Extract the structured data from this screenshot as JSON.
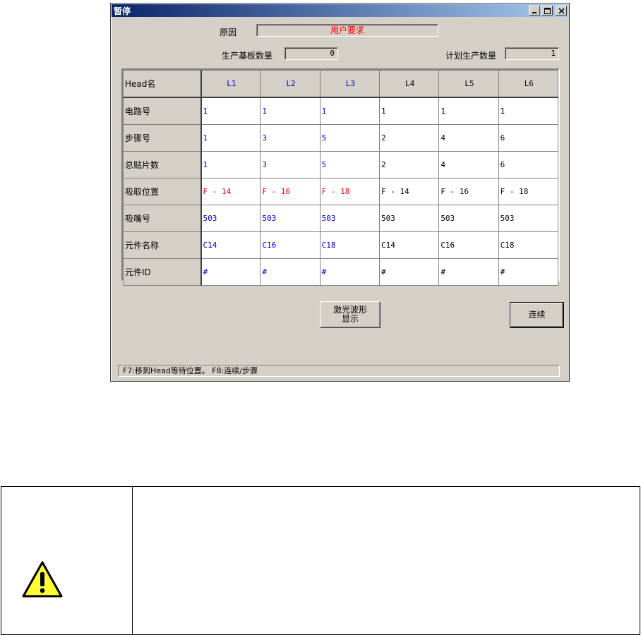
{
  "window": {
    "title": "暂停",
    "controls": [
      "minimize-icon",
      "maximize-icon",
      "close-icon"
    ]
  },
  "reason": {
    "label": "原因",
    "value": "用户要求",
    "value_color": "#ff0000"
  },
  "produced_boards": {
    "label": "生产基板数量",
    "value": "0"
  },
  "planned_quantity": {
    "label": "计划生产数量",
    "value": "1"
  },
  "grid": {
    "header_label": "Head名",
    "columns": [
      "L1",
      "L2",
      "L3",
      "L4",
      "L5",
      "L6"
    ],
    "rows": [
      {
        "label": "电路号",
        "values": [
          "1",
          "1",
          "1",
          "1",
          "1",
          "1"
        ]
      },
      {
        "label": "步骤号",
        "values": [
          "1",
          "3",
          "5",
          "2",
          "4",
          "6"
        ]
      },
      {
        "label": "总贴片数",
        "values": [
          "1",
          "3",
          "5",
          "2",
          "4",
          "6"
        ]
      },
      {
        "label": "吸取位置",
        "values": [
          "F - 14",
          "F - 16",
          "F - 18",
          "F - 14",
          "F - 16",
          "F - 18"
        ]
      },
      {
        "label": "吸嘴号",
        "values": [
          "503",
          "503",
          "503",
          "503",
          "503",
          "503"
        ]
      },
      {
        "label": "元件名称",
        "values": [
          "C14",
          "C16",
          "C18",
          "C14",
          "C16",
          "C18"
        ]
      },
      {
        "label": "元件ID",
        "values": [
          "#",
          "#",
          "#",
          "#",
          "#",
          "#"
        ]
      }
    ],
    "colors": {
      "highlight_columns": "#0000cc",
      "pickup_highlight": "#e00000",
      "normal": "#000000"
    }
  },
  "buttons": {
    "laser_line1": "激光波形",
    "laser_line2": "显示",
    "continue": "连续"
  },
  "status_bar": "F7:移到Head等待位置。 F8:连续/步骤",
  "warning": {
    "icon": "warning-triangle-icon",
    "icon_color": "#ffff33"
  }
}
